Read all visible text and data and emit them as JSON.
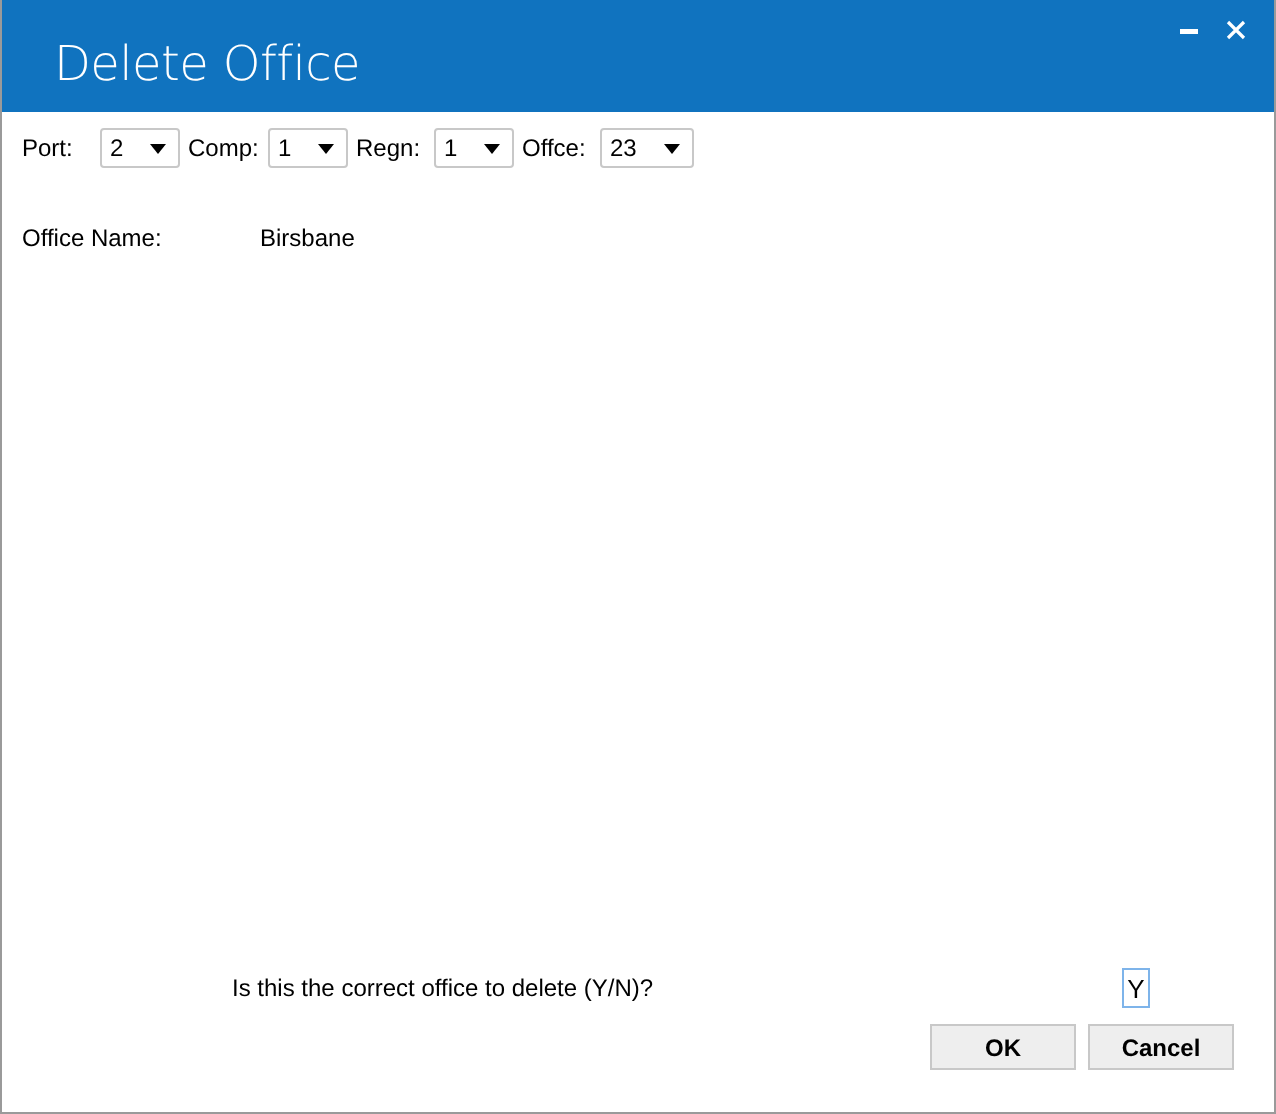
{
  "window": {
    "title": "Delete Office"
  },
  "selectors": [
    {
      "label": "Port:",
      "value": "2"
    },
    {
      "label": "Comp:",
      "value": "1"
    },
    {
      "label": "Regn:",
      "value": "1"
    },
    {
      "label": "Offce:",
      "value": "23"
    }
  ],
  "office_name": {
    "label": "Office Name:",
    "value": "Birsbane"
  },
  "confirm": {
    "question": "Is this the correct office to delete (Y/N)?",
    "answer": "Y"
  },
  "buttons": [
    "OK",
    "Cancel"
  ]
}
